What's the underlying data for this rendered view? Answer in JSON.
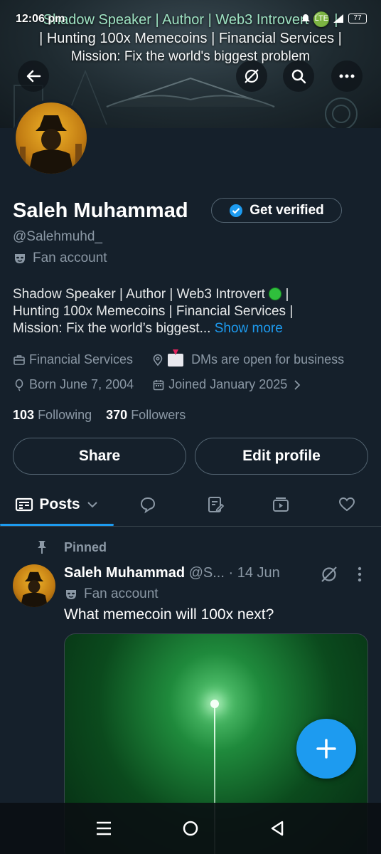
{
  "status": {
    "time": "12:06 pm",
    "network_label": "LTE",
    "battery": "77"
  },
  "banner": {
    "line1": "Shadow Speaker | Author | Web3 Introvert 🟢 |",
    "line2": "| Hunting 100x Memecoins | Financial Services |",
    "line3": "Mission: Fix the world's biggest problem"
  },
  "profile": {
    "name": "Saleh Muhammad",
    "get_verified_label": "Get verified",
    "handle": "@Salehmuhd_",
    "fan_label": "Fan account",
    "bio_line1": "Shadow Speaker | Author | Web3 Introvert",
    "bio_line1_tail": "|",
    "bio_line2": "Hunting 100x Memecoins | Financial Services |",
    "bio_line3": "Mission: Fix the world’s biggest...",
    "show_more": "Show more",
    "category": "Financial Services",
    "location": "DMs are open for business",
    "born": "Born June 7, 2004",
    "joined": "Joined January 2025",
    "following_count": "103",
    "following_label": "Following",
    "followers_count": "370",
    "followers_label": "Followers",
    "share_label": "Share",
    "edit_label": "Edit profile"
  },
  "tabs": {
    "posts_label": "Posts",
    "icons": [
      "replies-icon",
      "articles-icon",
      "media-icon",
      "likes-icon"
    ]
  },
  "post": {
    "pinned_label": "Pinned",
    "author": "Saleh Muhammad",
    "handle": "@S...",
    "separator": "·",
    "date": "14 Jun",
    "fan_label": "Fan account",
    "text": "What memecoin will 100x next?"
  },
  "colors": {
    "background": "#15202b",
    "accent": "#1d9bf0",
    "muted": "#8b98a5",
    "border": "#536471"
  }
}
